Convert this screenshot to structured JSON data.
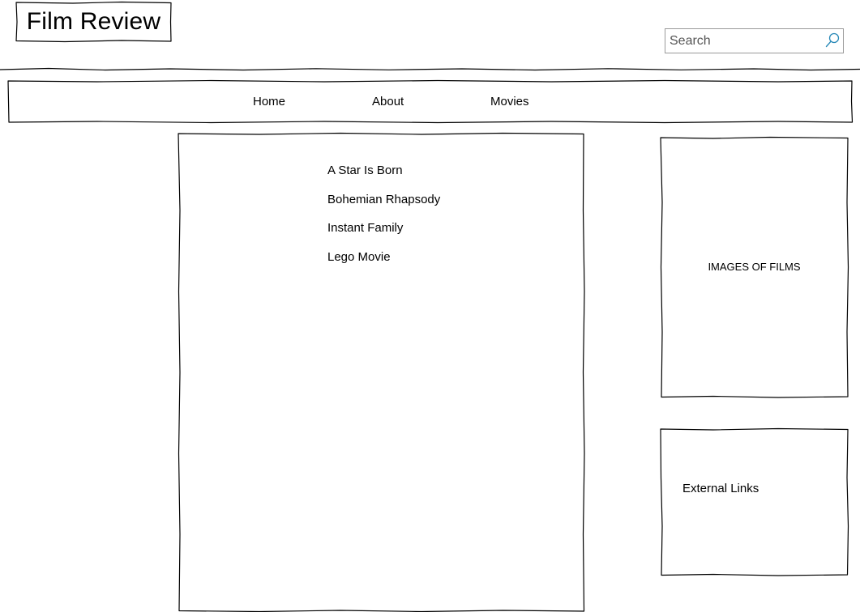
{
  "header": {
    "title": "Film Review",
    "search": {
      "placeholder": "Search",
      "value": "",
      "icon": "search-icon"
    }
  },
  "nav": {
    "items": [
      {
        "label": "Home"
      },
      {
        "label": "About"
      },
      {
        "label": "Movies"
      }
    ]
  },
  "main": {
    "movies": [
      {
        "title": "A Star Is Born"
      },
      {
        "title": "Bohemian Rhapsody"
      },
      {
        "title": "Instant Family"
      },
      {
        "title": "Lego Movie"
      }
    ]
  },
  "sidebar": {
    "images_label": "IMAGES OF FILMS",
    "links_label": "External Links"
  },
  "colors": {
    "line": "#000000",
    "search_border": "#9a9a9a",
    "search_icon": "#2a8ab8"
  }
}
